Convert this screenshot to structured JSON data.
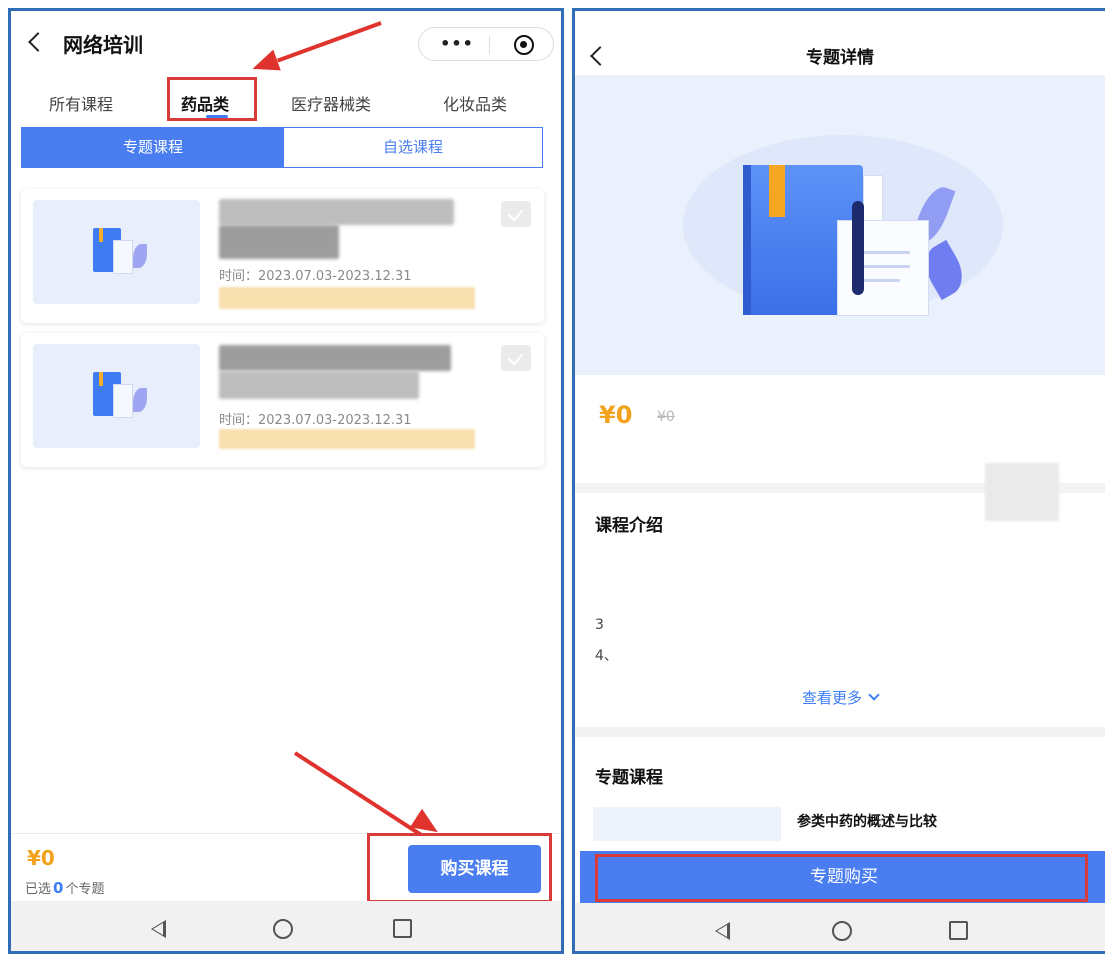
{
  "left": {
    "title": "网络培训",
    "capsule_more": "•••",
    "category_tabs": [
      "所有课程",
      "药品类",
      "医疗器械类",
      "化妆品类"
    ],
    "active_category": "药品类",
    "segments": [
      "专题课程",
      "自选课程"
    ],
    "active_segment": "专题课程",
    "courses": [
      {
        "time": "时间：2023.07.03-2023.12.31"
      },
      {
        "time": "时间：2023.07.03-2023.12.31"
      }
    ],
    "price": "¥0",
    "selected_prefix": "已选",
    "selected_count": "0",
    "selected_suffix": "个专题",
    "buy_button": "购买课程"
  },
  "right": {
    "title": "专题详情",
    "price": "¥0",
    "original_price": "¥0",
    "intro_title": "课程介绍",
    "intro_lines": [
      "3",
      "4、"
    ],
    "view_more": "查看更多",
    "topic_courses_title": "专题课程",
    "course_title": "参类中药的概述与比较",
    "topic_buy_button": "专题购买"
  },
  "colors": {
    "accent": "#4a7ef0",
    "price": "#f2a31b",
    "highlight": "#d93a3a",
    "frame": "#2f6db7"
  },
  "icons": [
    "back-icon",
    "more-icon",
    "target-icon",
    "checkbox-icon",
    "nav-back-icon",
    "nav-home-icon",
    "nav-recent-icon",
    "chevron-down-icon"
  ]
}
